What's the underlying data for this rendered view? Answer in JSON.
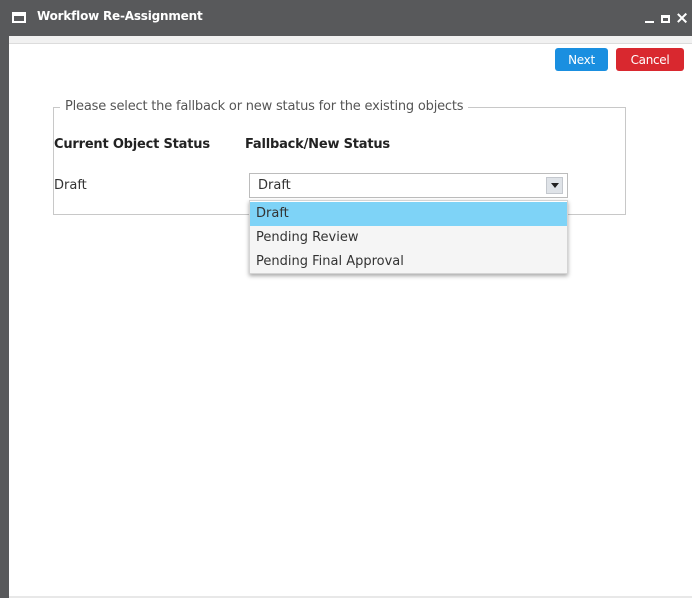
{
  "window": {
    "title": "Workflow Re-Assignment",
    "icon": "window-icon",
    "controls": [
      "minimize-icon",
      "maximize-icon",
      "close-icon"
    ]
  },
  "toolbar": {
    "next_label": "Next",
    "cancel_label": "Cancel"
  },
  "form": {
    "legend": "Please select the fallback or new status for the existing objects",
    "col_current": "Current Object Status",
    "col_new": "Fallback/New Status",
    "rows": [
      {
        "current": "Draft",
        "selected": "Draft"
      }
    ]
  },
  "dropdown": {
    "options": [
      "Draft",
      "Pending Review",
      "Pending Final Approval"
    ],
    "highlighted_index": 0
  },
  "colors": {
    "titlebar": "#58595b",
    "next": "#1a8fe0",
    "cancel": "#d9282f",
    "highlight": "#7ed3f7"
  }
}
